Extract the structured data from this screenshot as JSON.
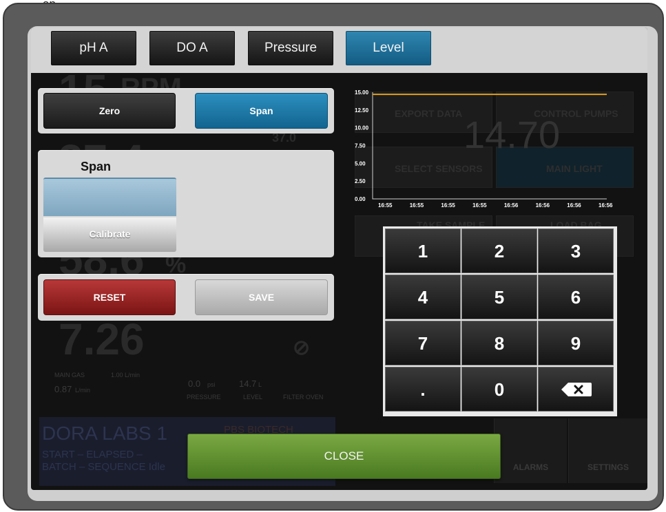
{
  "page_caption": "ap",
  "tabs": [
    {
      "label": "pH A",
      "active": false
    },
    {
      "label": "DO A",
      "active": false
    },
    {
      "label": "Pressure",
      "active": false
    },
    {
      "label": "Level",
      "active": true
    }
  ],
  "mode": {
    "zero_label": "Zero",
    "span_label": "Span",
    "selected": "Span"
  },
  "span_section": {
    "title": "Span",
    "input_value": "",
    "calibrate_label": "Calibrate"
  },
  "actions": {
    "reset_label": "RESET",
    "save_label": "SAVE"
  },
  "chart_data": {
    "type": "line",
    "x": [
      "16:55",
      "16:55",
      "16:55",
      "16:55",
      "16:56",
      "16:56",
      "16:56",
      "16:56"
    ],
    "series": [
      {
        "values": [
          14.7,
          14.7,
          14.7,
          14.7,
          14.7,
          14.7,
          14.7,
          14.7
        ]
      }
    ],
    "y_ticks": [
      "15.00",
      "12.50",
      "10.00",
      "7.50",
      "5.00",
      "2.50",
      "0.00"
    ],
    "ylim": [
      0,
      15
    ],
    "line_color": "#e0a020",
    "grid": false
  },
  "keypad": {
    "keys": [
      "1",
      "2",
      "3",
      "4",
      "5",
      "6",
      "7",
      "8",
      "9",
      ".",
      "0"
    ],
    "backspace_icon": "backspace-icon"
  },
  "close_label": "CLOSE",
  "background": {
    "rpm_value": "15",
    "rpm_unit": "RPM",
    "temp_value": "37.4",
    "temp_setpoint": "37.0",
    "do_value": "58.6",
    "do_unit": "%",
    "ph_value": "7.26",
    "main_gas_label": "MAIN GAS",
    "main_gas_setpoint": "1.00 L/min",
    "main_gas_value": "0.87",
    "main_gas_unit": "L/min",
    "pressure_value": "0.0",
    "pressure_unit": "psi",
    "pressure_label": "PRESSURE",
    "level_value": "14.7",
    "level_unit": "L",
    "level_label": "LEVEL",
    "filter_label": "FILTER OVEN",
    "lab_name": "DORA LABS 1",
    "brand": "PBS BIOTECH",
    "info_line1": "START  –  ELAPSED  –",
    "info_line2": "BATCH  –  SEQUENCE  Idle",
    "export_label": "EXPORT DATA",
    "control_pumps_label": "CONTROL PUMPS",
    "select_sensors_label": "SELECT SENSORS",
    "main_light_label": "MAIN LIGHT",
    "take_sample_label": "TAKE SAMPLE",
    "load_bag_label": "LOAD BAG",
    "level_big": "14.70",
    "alarms_label": "ALARMS",
    "settings_label": "SETTINGS"
  }
}
